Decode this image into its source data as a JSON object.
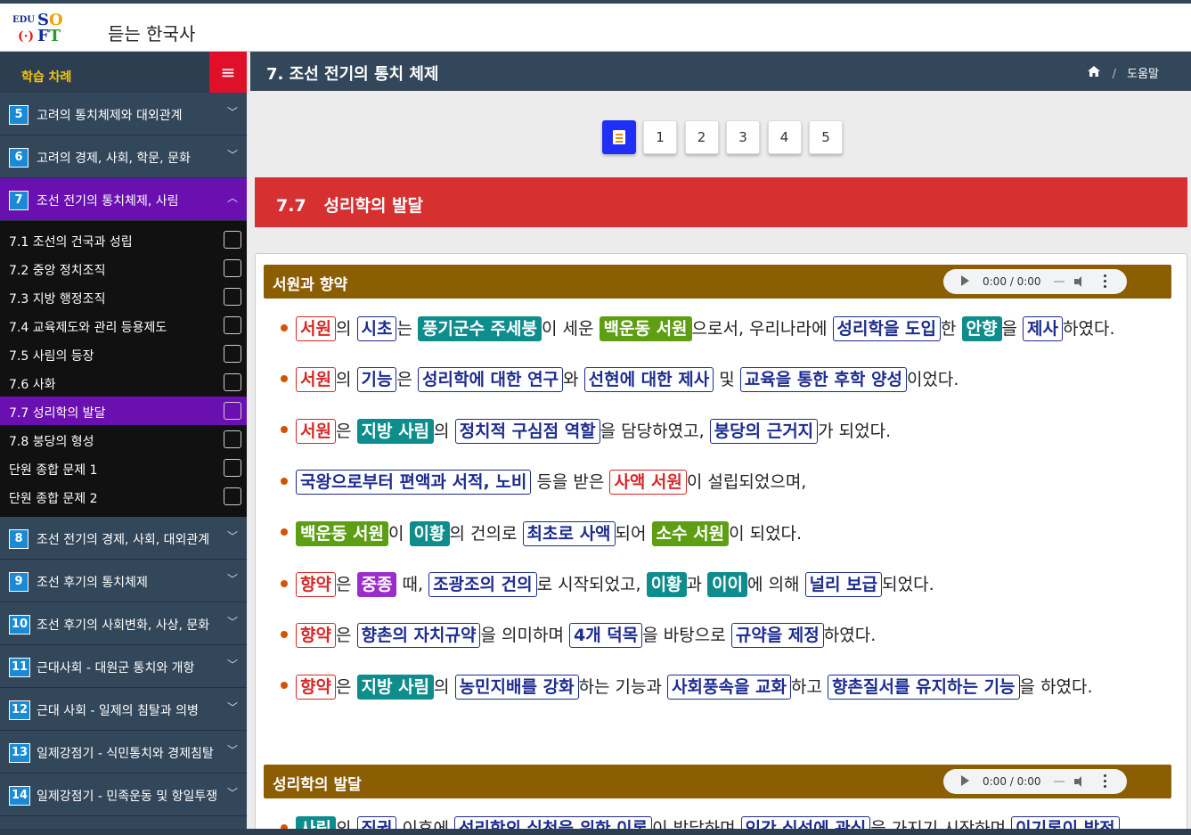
{
  "app": {
    "logo_edu": "EDU",
    "logo_so_1": "S",
    "logo_so_2": "O",
    "logo_paren": "(·)",
    "logo_ft_1": "F",
    "logo_ft_2": "T",
    "title": "듣는 한국사"
  },
  "sidebar": {
    "heading": "학습 차례",
    "menu_icon": "≡",
    "chapters_top": [
      {
        "num": "5",
        "label": "고려의 통치체제와 대외관계"
      },
      {
        "num": "6",
        "label": "고려의 경제, 사회, 학문, 문화"
      },
      {
        "num": "7",
        "label": "조선 전기의 통치체제, 사림"
      }
    ],
    "subitems": [
      {
        "label": "7.1 조선의 건국과 성립"
      },
      {
        "label": "7.2 중앙 정치조직"
      },
      {
        "label": "7.3 지방 행정조직"
      },
      {
        "label": "7.4 교육제도와 관리 등용제도"
      },
      {
        "label": "7.5 사림의 등장"
      },
      {
        "label": "7.6 사화"
      },
      {
        "label": "7.7 성리학의 발달"
      },
      {
        "label": "7.8 붕당의 형성"
      },
      {
        "label": "단원 종합 문제 1"
      },
      {
        "label": "단원 종합 문제 2"
      }
    ],
    "chapters_bottom": [
      {
        "num": "8",
        "label": "조선 전기의 경제, 사회, 대외관계"
      },
      {
        "num": "9",
        "label": "조선 후기의 통치체제"
      },
      {
        "num": "10",
        "label": "조선 후기의 사회변화, 사상, 문화"
      },
      {
        "num": "11",
        "label": "근대사회 - 대원군 통치와 개항"
      },
      {
        "num": "12",
        "label": "근대 사회 - 일제의 침탈과 의병"
      },
      {
        "num": "13",
        "label": "일제강점기 - 식민통치와 경제침탈"
      },
      {
        "num": "14",
        "label": "일제강점기 - 민족운동 및 항일투쟁"
      }
    ],
    "chevron_down": "﹀",
    "chevron_up": "︿"
  },
  "main": {
    "title": "7. 조선 전기의 통치 체제",
    "breadcrumb_sep": "/",
    "help": "도움말",
    "pages": [
      "1",
      "2",
      "3",
      "4",
      "5"
    ],
    "section_title": "7.7   성리학의 발달"
  },
  "sections": [
    {
      "title": "서원과 향약",
      "audio_time": "0:00 / 0:00",
      "lines": [
        [
          {
            "t": "서원",
            "s": "r"
          },
          {
            "t": "의 "
          },
          {
            "t": "시초",
            "s": "b"
          },
          {
            "t": "는 "
          },
          {
            "t": "풍기군수 주세붕",
            "s": "tl"
          },
          {
            "t": "이 세운 "
          },
          {
            "t": "백운동 서원",
            "s": "g"
          },
          {
            "t": "으로서, 우리나라에 "
          },
          {
            "t": "성리학을 도입",
            "s": "b"
          },
          {
            "t": "한 "
          },
          {
            "t": "안향",
            "s": "tl"
          },
          {
            "t": "을 "
          },
          {
            "t": "제사",
            "s": "b"
          },
          {
            "t": "하였다."
          }
        ],
        [
          {
            "t": "서원",
            "s": "r"
          },
          {
            "t": "의 "
          },
          {
            "t": "기능",
            "s": "b"
          },
          {
            "t": "은 "
          },
          {
            "t": "성리학에 대한 연구",
            "s": "b"
          },
          {
            "t": "와 "
          },
          {
            "t": "선현에 대한 제사",
            "s": "b"
          },
          {
            "t": " 및 "
          },
          {
            "t": "교육을 통한 후학 양성",
            "s": "b"
          },
          {
            "t": "이었다."
          }
        ],
        [
          {
            "t": "서원",
            "s": "r"
          },
          {
            "t": "은 "
          },
          {
            "t": "지방 사림",
            "s": "tl"
          },
          {
            "t": "의 "
          },
          {
            "t": "정치적 구심점 역할",
            "s": "b"
          },
          {
            "t": "을 담당하였고, "
          },
          {
            "t": "붕당의 근거지",
            "s": "b"
          },
          {
            "t": "가 되었다."
          }
        ],
        [
          {
            "t": "국왕으로부터 편액과 서적, 노비",
            "s": "b"
          },
          {
            "t": " 등을 받은 "
          },
          {
            "t": "사액 서원",
            "s": "r"
          },
          {
            "t": "이 설립되었으며,"
          }
        ],
        [
          {
            "t": "백운동 서원",
            "s": "g"
          },
          {
            "t": "이 "
          },
          {
            "t": "이황",
            "s": "tl"
          },
          {
            "t": "의 건의로 "
          },
          {
            "t": "최초로 사액",
            "s": "b"
          },
          {
            "t": "되어 "
          },
          {
            "t": "소수 서원",
            "s": "g"
          },
          {
            "t": "이 되었다."
          }
        ],
        [
          {
            "t": "향약",
            "s": "r"
          },
          {
            "t": "은 "
          },
          {
            "t": "중종",
            "s": "p"
          },
          {
            "t": " 때, "
          },
          {
            "t": "조광조의 건의",
            "s": "b"
          },
          {
            "t": "로 시작되었고, "
          },
          {
            "t": "이황",
            "s": "tl"
          },
          {
            "t": "과 "
          },
          {
            "t": "이이",
            "s": "tl"
          },
          {
            "t": "에 의해 "
          },
          {
            "t": "널리 보급",
            "s": "b"
          },
          {
            "t": "되었다."
          }
        ],
        [
          {
            "t": "향약",
            "s": "r"
          },
          {
            "t": "은 "
          },
          {
            "t": "향촌의 자치규약",
            "s": "b"
          },
          {
            "t": "을 의미하며 "
          },
          {
            "t": "4개 덕목",
            "s": "b"
          },
          {
            "t": "을 바탕으로 "
          },
          {
            "t": "규약을 제정",
            "s": "b"
          },
          {
            "t": "하였다."
          }
        ],
        [
          {
            "t": "향약",
            "s": "r"
          },
          {
            "t": "은 "
          },
          {
            "t": "지방 사림",
            "s": "tl"
          },
          {
            "t": "의 "
          },
          {
            "t": "농민지배를 강화",
            "s": "b"
          },
          {
            "t": "하는 기능과 "
          },
          {
            "t": "사회풍속을 교화",
            "s": "b"
          },
          {
            "t": "하고 "
          },
          {
            "t": "향촌질서를 유지하는 기능",
            "s": "b"
          },
          {
            "t": "을 하였다."
          }
        ]
      ]
    },
    {
      "title": "성리학의 발달",
      "audio_time": "0:00 / 0:00",
      "lines": [
        [
          {
            "t": "사림",
            "s": "tl"
          },
          {
            "t": "의 "
          },
          {
            "t": "집권",
            "s": "b"
          },
          {
            "t": " 이후에 "
          },
          {
            "t": "성리학의 실천을 위한 이론",
            "s": "b"
          },
          {
            "t": "이 발달하며 "
          },
          {
            "t": "인간 심성에 관심",
            "s": "b"
          },
          {
            "t": "을 가지기 시작하며 "
          },
          {
            "t": "이기론이 발전",
            "s": "b"
          }
        ]
      ]
    }
  ],
  "colors": {
    "sidebar": "#33475b",
    "active": "#6a0fb0",
    "banner": "#d63031",
    "section_head": "#8b5e04",
    "pager_active": "#1f2ff5"
  },
  "icons": {
    "home": "home-icon",
    "menu": "hamburger-icon",
    "page": "document-icon"
  }
}
